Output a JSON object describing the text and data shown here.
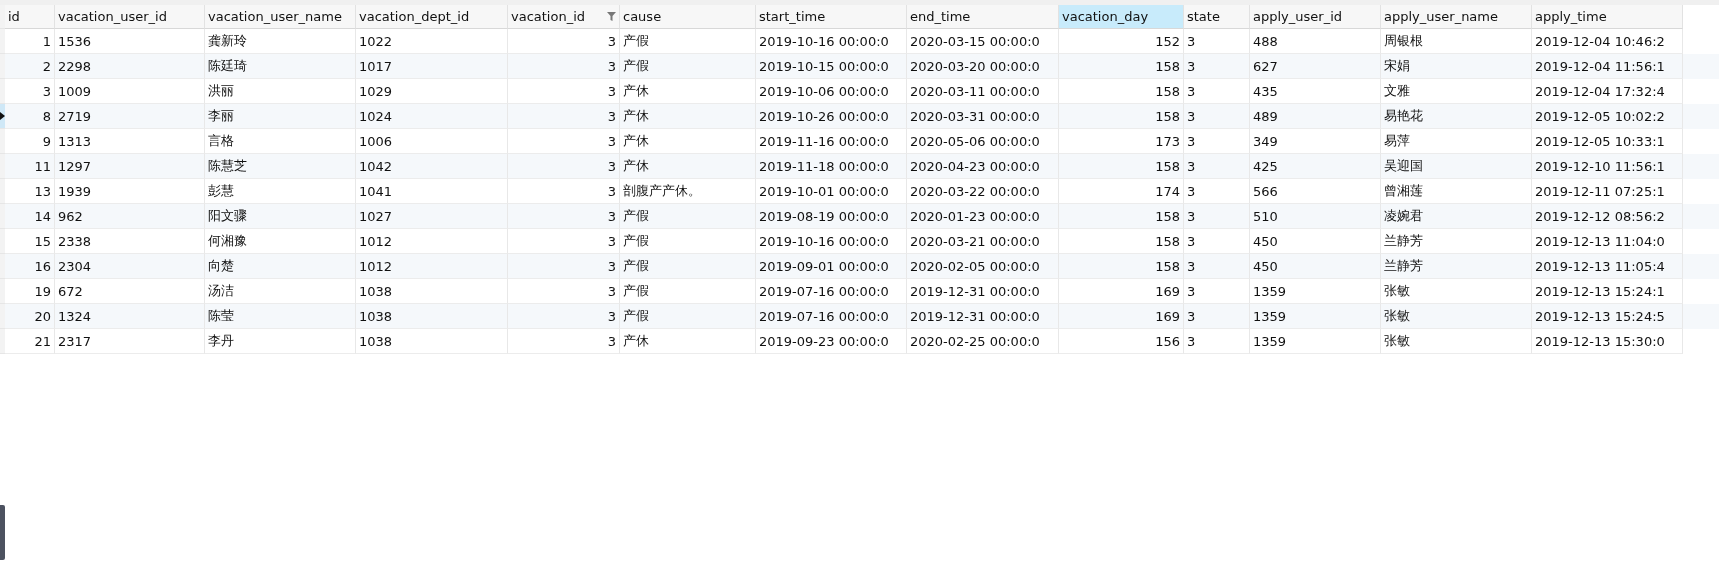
{
  "table": {
    "columns": [
      {
        "label": "id",
        "kind": "number",
        "selected": false,
        "filter": false
      },
      {
        "label": "vacation_user_id",
        "kind": "text",
        "selected": false,
        "filter": false
      },
      {
        "label": "vacation_user_name",
        "kind": "text",
        "selected": false,
        "filter": false
      },
      {
        "label": "vacation_dept_id",
        "kind": "text",
        "selected": false,
        "filter": false
      },
      {
        "label": "vacation_id",
        "kind": "number",
        "selected": false,
        "filter": true
      },
      {
        "label": "cause",
        "kind": "text",
        "selected": false,
        "filter": false
      },
      {
        "label": "start_time",
        "kind": "text",
        "selected": false,
        "filter": false
      },
      {
        "label": "end_time",
        "kind": "text",
        "selected": false,
        "filter": false
      },
      {
        "label": "vacation_day",
        "kind": "number",
        "selected": true,
        "filter": false
      },
      {
        "label": "state",
        "kind": "text",
        "selected": false,
        "filter": false
      },
      {
        "label": "apply_user_id",
        "kind": "text",
        "selected": false,
        "filter": false
      },
      {
        "label": "apply_user_name",
        "kind": "text",
        "selected": false,
        "filter": false
      },
      {
        "label": "apply_time",
        "kind": "text",
        "selected": false,
        "filter": false
      }
    ],
    "rows": [
      {
        "current": false,
        "cells": [
          "1",
          "1536",
          "龚新玲",
          "1022",
          "3",
          "产假",
          "2019-10-16 00:00:0",
          "2020-03-15 00:00:0",
          "152",
          "3",
          "488",
          "周银根",
          "2019-12-04 10:46:2"
        ]
      },
      {
        "current": false,
        "cells": [
          "2",
          "2298",
          "陈廷琦",
          "1017",
          "3",
          "产假",
          "2019-10-15 00:00:0",
          "2020-03-20 00:00:0",
          "158",
          "3",
          "627",
          "宋娟",
          "2019-12-04 11:56:1"
        ]
      },
      {
        "current": false,
        "cells": [
          "3",
          "1009",
          "洪丽",
          "1029",
          "3",
          "产休",
          "2019-10-06 00:00:0",
          "2020-03-11 00:00:0",
          "158",
          "3",
          "435",
          "文雅",
          "2019-12-04 17:32:4"
        ]
      },
      {
        "current": true,
        "cells": [
          "8",
          "2719",
          "李丽",
          "1024",
          "3",
          "产休",
          "2019-10-26 00:00:0",
          "2020-03-31 00:00:0",
          "158",
          "3",
          "489",
          "易艳花",
          "2019-12-05 10:02:2"
        ]
      },
      {
        "current": false,
        "cells": [
          "9",
          "1313",
          "言格",
          "1006",
          "3",
          "产休",
          "2019-11-16 00:00:0",
          "2020-05-06 00:00:0",
          "173",
          "3",
          "349",
          "易萍",
          "2019-12-05 10:33:1"
        ]
      },
      {
        "current": false,
        "cells": [
          "11",
          "1297",
          "陈慧芝",
          "1042",
          "3",
          "产休",
          "2019-11-18 00:00:0",
          "2020-04-23 00:00:0",
          "158",
          "3",
          "425",
          "吴迎国",
          "2019-12-10 11:56:1"
        ]
      },
      {
        "current": false,
        "cells": [
          "13",
          "1939",
          "彭慧",
          "1041",
          "3",
          "剖腹产产休。",
          "2019-10-01 00:00:0",
          "2020-03-22 00:00:0",
          "174",
          "3",
          "566",
          "曾湘莲",
          "2019-12-11 07:25:1"
        ]
      },
      {
        "current": false,
        "cells": [
          "14",
          "962",
          "阳文骤",
          "1027",
          "3",
          "产假",
          "2019-08-19 00:00:0",
          "2020-01-23 00:00:0",
          "158",
          "3",
          "510",
          "凌婉君",
          "2019-12-12 08:56:2"
        ]
      },
      {
        "current": false,
        "cells": [
          "15",
          "2338",
          "何湘豫",
          "1012",
          "3",
          "产假",
          "2019-10-16 00:00:0",
          "2020-03-21 00:00:0",
          "158",
          "3",
          "450",
          "兰静芳",
          "2019-12-13 11:04:0"
        ]
      },
      {
        "current": false,
        "cells": [
          "16",
          "2304",
          "向楚",
          "1012",
          "3",
          "产假",
          "2019-09-01 00:00:0",
          "2020-02-05 00:00:0",
          "158",
          "3",
          "450",
          "兰静芳",
          "2019-12-13 11:05:4"
        ]
      },
      {
        "current": false,
        "cells": [
          "19",
          "672",
          "汤洁",
          "1038",
          "3",
          "产假",
          "2019-07-16 00:00:0",
          "2019-12-31 00:00:0",
          "169",
          "3",
          "1359",
          "张敏",
          "2019-12-13 15:24:1"
        ]
      },
      {
        "current": false,
        "cells": [
          "20",
          "1324",
          "陈莹",
          "1038",
          "3",
          "产假",
          "2019-07-16 00:00:0",
          "2019-12-31 00:00:0",
          "169",
          "3",
          "1359",
          "张敏",
          "2019-12-13 15:24:5"
        ]
      },
      {
        "current": false,
        "cells": [
          "21",
          "2317",
          "李丹",
          "1038",
          "3",
          "产休",
          "2019-09-23 00:00:0",
          "2020-02-25 00:00:0",
          "156",
          "3",
          "1359",
          "张敏",
          "2019-12-13 15:30:0"
        ]
      }
    ]
  }
}
